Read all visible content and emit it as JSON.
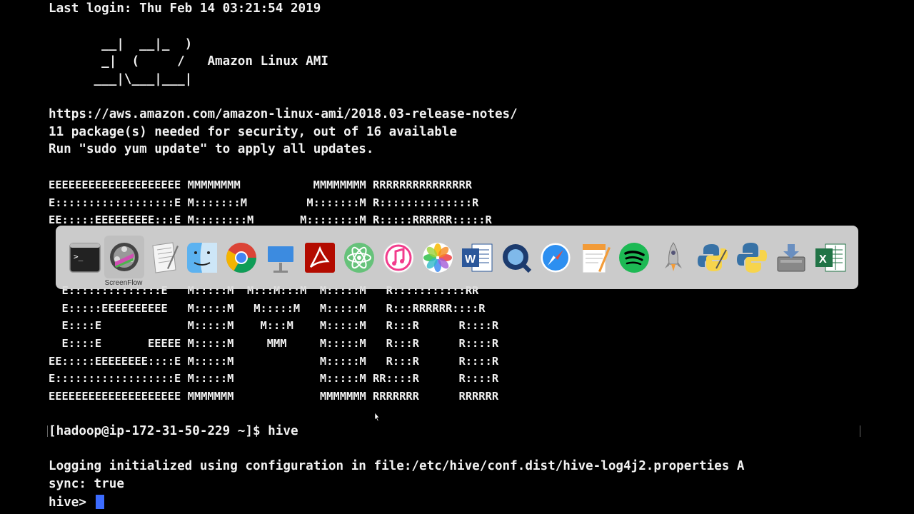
{
  "terminal": {
    "last_login": "Last login: Thu Feb 14 03:21:54 2019",
    "ami_art_1": "       __|  __|_  )",
    "ami_art_2": "       _|  (     /   Amazon Linux AMI",
    "ami_art_3": "      ___|\\___|___|",
    "release_url": "https://aws.amazon.com/amazon-linux-ami/2018.03-release-notes/",
    "security_msg": "11 package(s) needed for security, out of 16 available",
    "update_msg": "Run \"sudo yum update\" to apply all updates.",
    "emr_1": "EEEEEEEEEEEEEEEEEEEE MMMMMMMM           MMMMMMMM RRRRRRRRRRRRRRR",
    "emr_2": "E::::::::::::::::::E M:::::::M         M:::::::M R::::::::::::::R",
    "emr_3": "EE:::::EEEEEEEEE:::E M::::::::M       M::::::::M R:::::RRRRRR:::::R",
    "emr_6": "  E::::::::::::::E   M:::::M  M:::M:::M  M:::::M   R:::::::::::RR",
    "emr_7": "  E:::::EEEEEEEEEE   M:::::M   M:::::M   M:::::M   R:::RRRRRR::::R",
    "emr_8": "  E::::E             M:::::M    M:::M    M:::::M   R:::R      R::::R",
    "emr_9": "  E::::E       EEEEE M:::::M     MMM     M:::::M   R:::R      R::::R",
    "emr_10": "EE:::::EEEEEEEE::::E M:::::M             M:::::M   R:::R      R::::R",
    "emr_11": "E::::::::::::::::::E M:::::M             M:::::M RR::::R      R::::R",
    "emr_12": "EEEEEEEEEEEEEEEEEEEE MMMMMMM             MMMMMMM RRRRRRR      RRRRRR",
    "prompt_cmd": "[hadoop@ip-172-31-50-229 ~]$ hive",
    "logging_1": "Logging initialized using configuration in file:/etc/hive/conf.dist/hive-log4j2.properties A",
    "logging_2": "sync: true",
    "hive_prompt": "hive> "
  },
  "dock": {
    "tooltip": "ScreenFlow",
    "apps": [
      "terminal-icon",
      "screenflow-icon",
      "textedit-icon",
      "finder-icon",
      "chrome-icon",
      "keynote-icon",
      "acrobat-icon",
      "atom-icon",
      "itunes-icon",
      "photos-icon",
      "word-icon",
      "quicktime-icon",
      "safari-icon",
      "pages-icon",
      "spotify-icon",
      "rocket-icon",
      "python-launcher-icon",
      "python-icon",
      "archive-utility-icon",
      "excel-icon"
    ]
  },
  "colors": {
    "background": "#000000",
    "text": "#f2f2f2",
    "cursor": "#3c6cff",
    "dock": "#dcdcdc"
  }
}
